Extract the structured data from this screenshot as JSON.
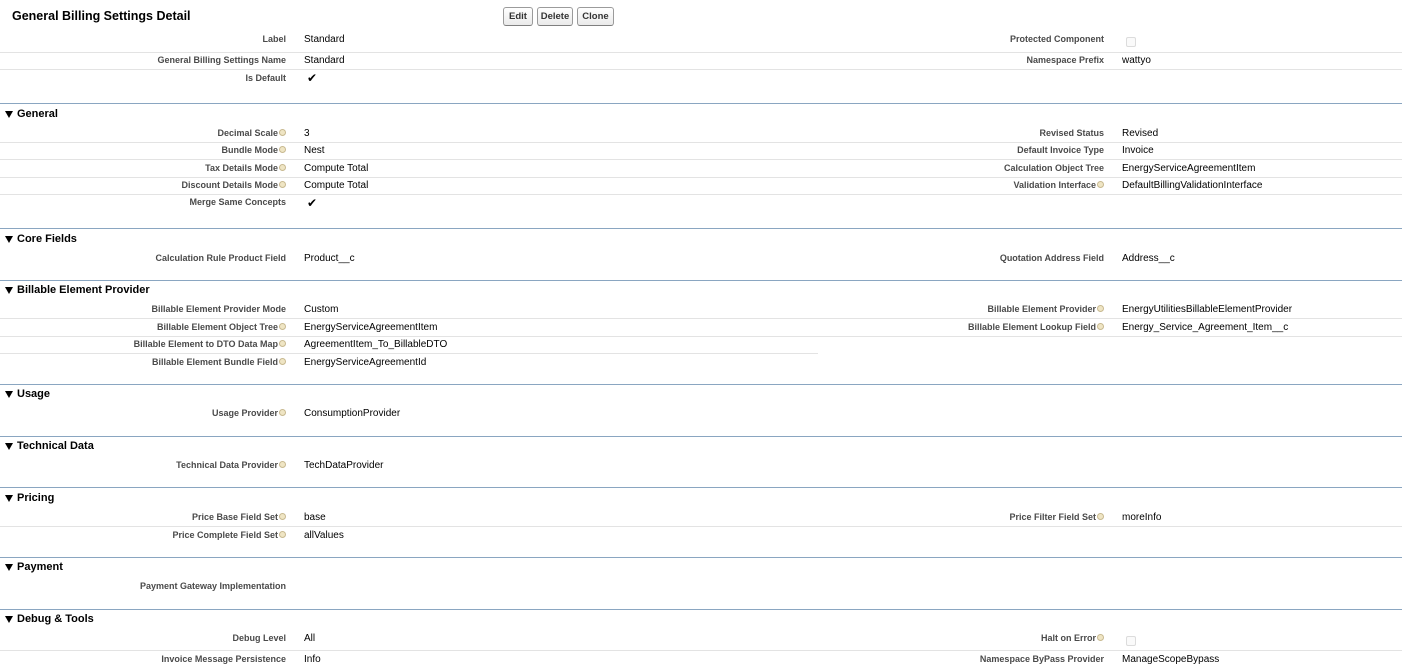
{
  "header": {
    "title": "General Billing Settings Detail",
    "edit_label": "Edit",
    "delete_label": "Delete",
    "clone_label": "Clone"
  },
  "top": {
    "label_label": "Label",
    "label_value": "Standard",
    "name_label": "General Billing Settings Name",
    "name_value": "Standard",
    "is_default_label": "Is Default",
    "is_default_checked": true,
    "protected_label": "Protected Component",
    "protected_checked": false,
    "namespace_prefix_label": "Namespace Prefix",
    "namespace_prefix_value": "wattyo"
  },
  "general": {
    "title": "General",
    "decimal_scale_label": "Decimal Scale",
    "decimal_scale_value": "3",
    "bundle_mode_label": "Bundle Mode",
    "bundle_mode_value": "Nest",
    "tax_details_label": "Tax Details Mode",
    "tax_details_value": "Compute Total",
    "discount_details_label": "Discount Details Mode",
    "discount_details_value": "Compute Total",
    "merge_label": "Merge Same Concepts",
    "merge_checked": true,
    "revised_status_label": "Revised Status",
    "revised_status_value": "Revised",
    "default_invoice_type_label": "Default Invoice Type",
    "default_invoice_type_value": "Invoice",
    "calc_object_tree_label": "Calculation Object Tree",
    "calc_object_tree_value": "EnergyServiceAgreementItem",
    "validation_interface_label": "Validation Interface",
    "validation_interface_value": "DefaultBillingValidationInterface"
  },
  "core_fields": {
    "title": "Core Fields",
    "calc_rule_label": "Calculation Rule Product Field",
    "calc_rule_value": "Product__c",
    "quotation_address_label": "Quotation Address Field",
    "quotation_address_value": "Address__c"
  },
  "billable": {
    "title": "Billable Element Provider",
    "mode_label": "Billable Element Provider Mode",
    "mode_value": "Custom",
    "object_tree_label": "Billable Element Object Tree",
    "object_tree_value": "EnergyServiceAgreementItem",
    "dto_label": "Billable Element to DTO Data Map",
    "dto_value": "AgreementItem_To_BillableDTO",
    "bundle_label": "Billable Element Bundle Field",
    "bundle_value": "EnergyServiceAgreementId",
    "provider_label": "Billable Element Provider",
    "provider_value": "EnergyUtilitiesBillableElementProvider",
    "lookup_label": "Billable Element Lookup Field",
    "lookup_value": "Energy_Service_Agreement_Item__c"
  },
  "usage": {
    "title": "Usage",
    "provider_label": "Usage Provider",
    "provider_value": "ConsumptionProvider"
  },
  "technical": {
    "title": "Technical Data",
    "provider_label": "Technical Data Provider",
    "provider_value": "TechDataProvider"
  },
  "pricing": {
    "title": "Pricing",
    "base_label": "Price Base Field Set",
    "base_value": "base",
    "complete_label": "Price Complete Field Set",
    "complete_value": "allValues",
    "filter_label": "Price Filter Field Set",
    "filter_value": "moreInfo"
  },
  "payment": {
    "title": "Payment",
    "gateway_label": "Payment Gateway Implementation",
    "gateway_value": ""
  },
  "debug": {
    "title": "Debug & Tools",
    "level_label": "Debug Level",
    "level_value": "All",
    "persistence_label": "Invoice Message Persistence",
    "persistence_value": "Info",
    "halt_label": "Halt on Error",
    "halt_checked": false,
    "bypass_label": "Namespace ByPass Provider",
    "bypass_value": "ManageScopeBypass"
  },
  "icons": {
    "help": "help-icon",
    "collapse": "triangle-down-icon",
    "check": "checkmark-icon"
  },
  "colors": {
    "section_line": "#8aa6c1",
    "row_line": "#e3e3e3",
    "label": "#4a4a4a"
  }
}
